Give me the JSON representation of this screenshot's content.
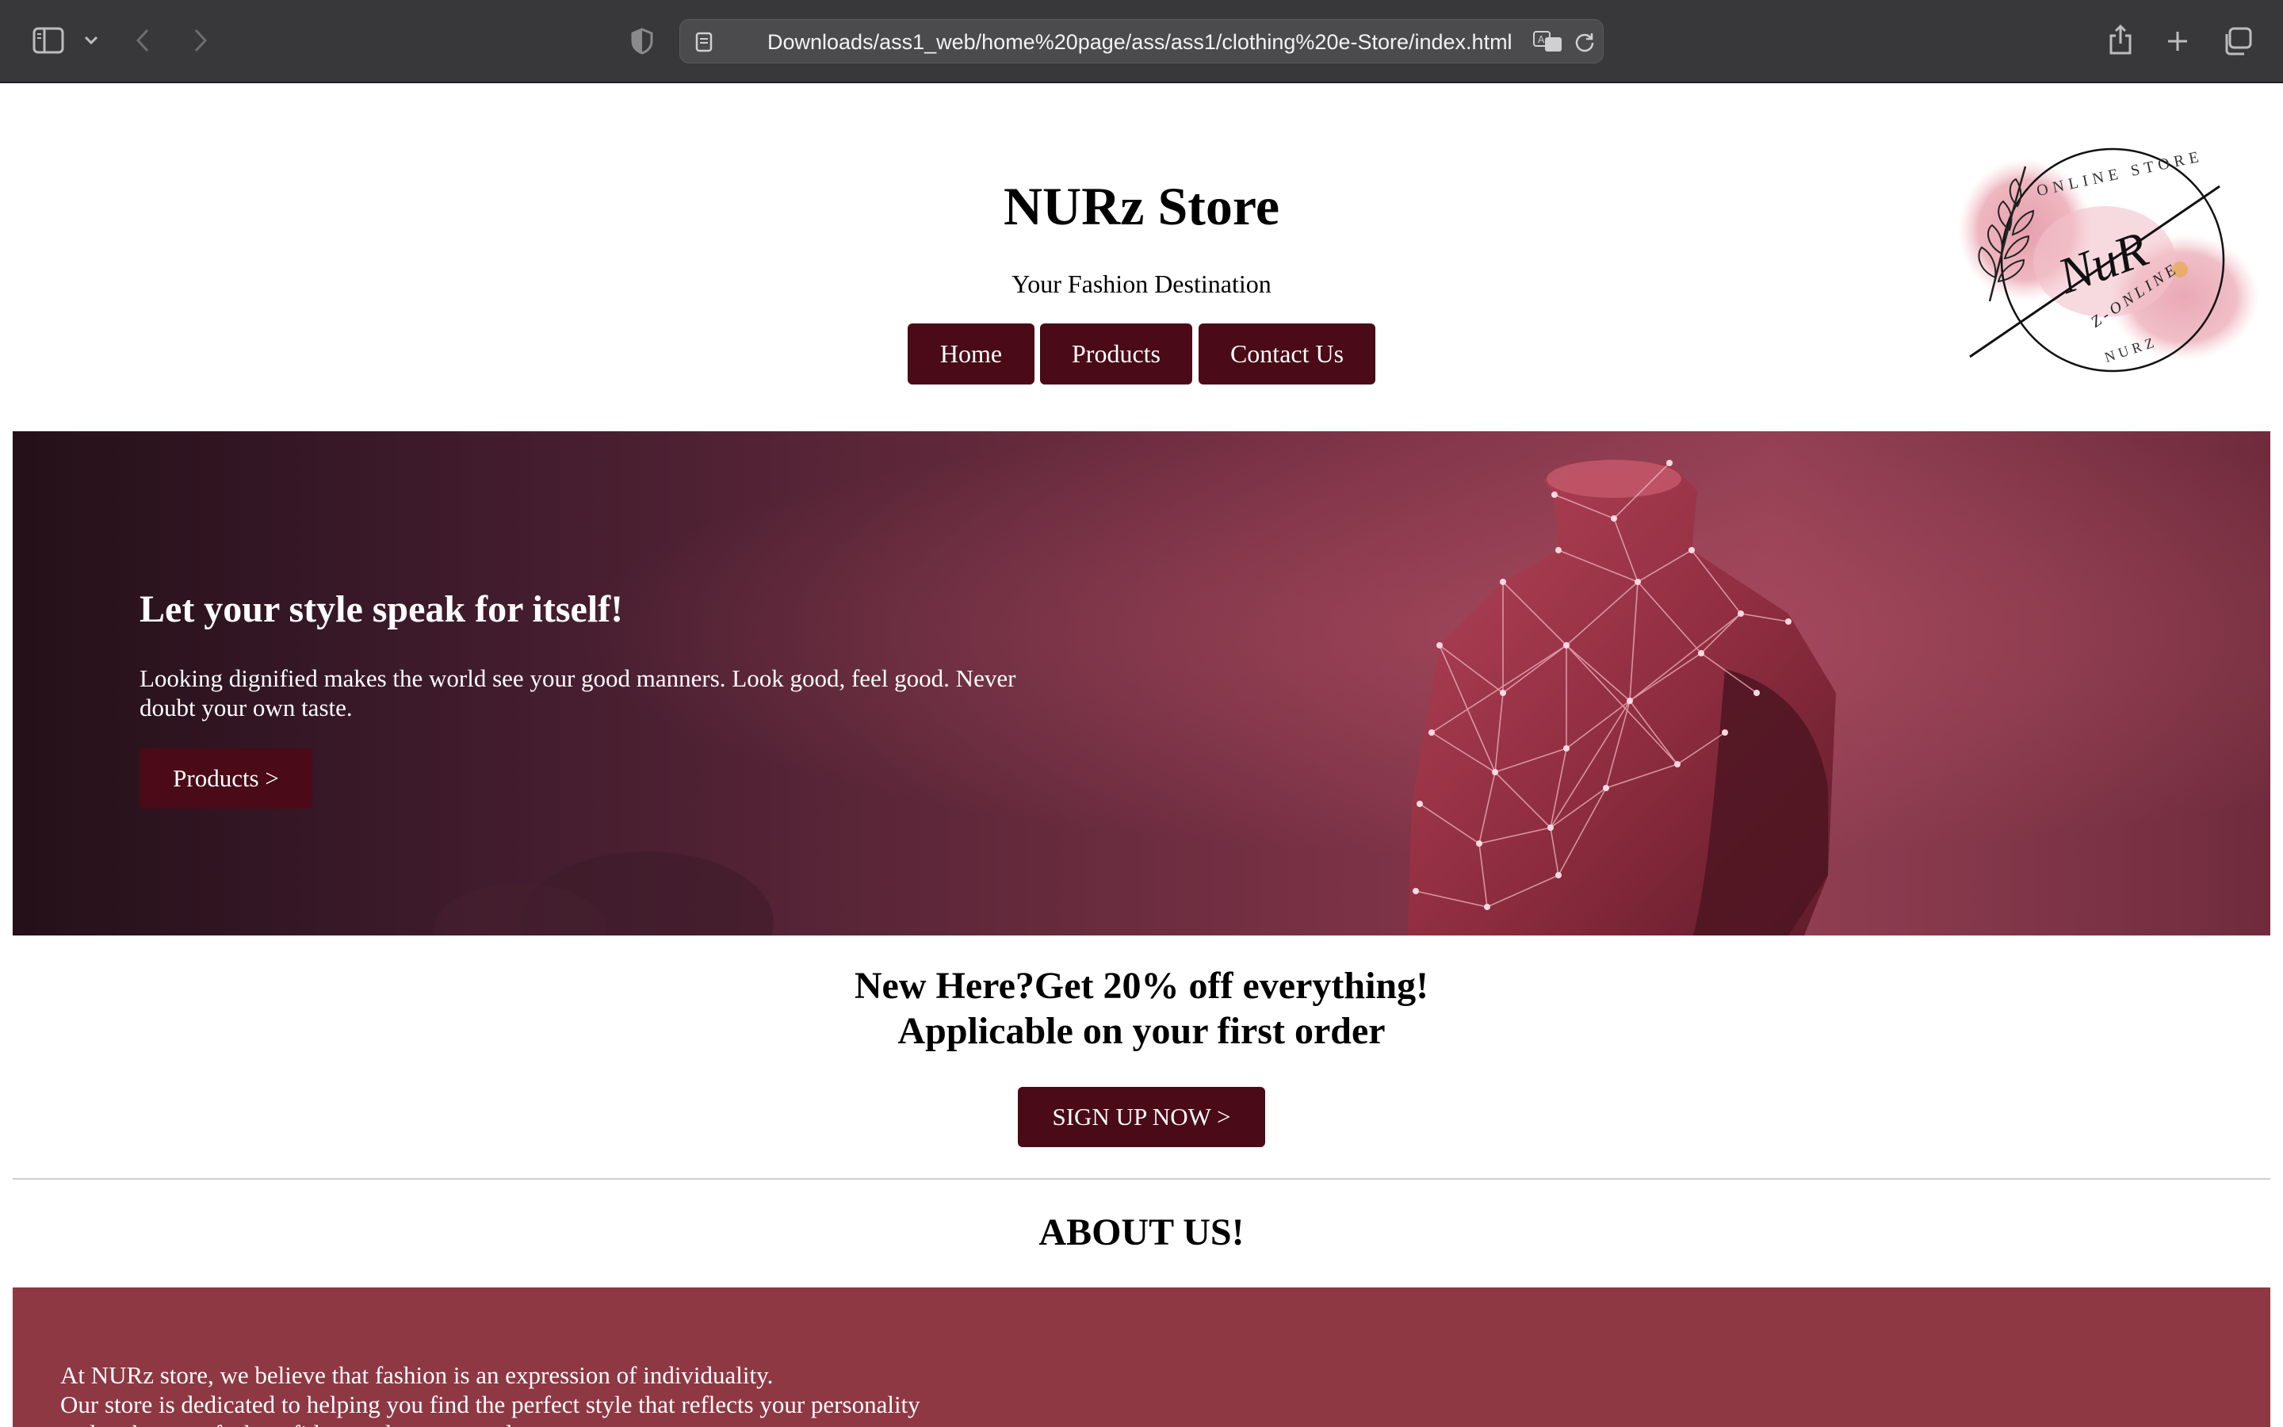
{
  "browser": {
    "url": "Downloads/ass1_web/home%20page/ass/ass1/clothing%20e-Store/index.html"
  },
  "header": {
    "title": "NURz Store",
    "tagline": "Your Fashion Destination",
    "nav": [
      "Home",
      "Products",
      "Contact Us"
    ]
  },
  "logo": {
    "top_text": "ONLINE STORE",
    "monogram": "NuR",
    "band_text": "Z-ONLINE",
    "bottom_text": "NURZ"
  },
  "hero": {
    "title": "Let your style speak for itself!",
    "text": "Looking dignified makes the world see your good manners. Look good, feel good. Never doubt your own taste.",
    "button": "Products >"
  },
  "promo": {
    "line1": "New Here?Get 20% off everything!",
    "line2": "Applicable on your first order",
    "button": "SIGN UP NOW >"
  },
  "about": {
    "title": "ABOUT US!",
    "line1": "At NURz store, we believe that fashion is an expression of individuality.",
    "line2": "Our store is dedicated to helping you find the perfect style that reflects your personality",
    "line3": "and makes you feel confident and empowered."
  },
  "colors": {
    "brand_dark": "#4a0a17",
    "about_bg": "#8e3843",
    "chrome_bg": "#38383a"
  }
}
